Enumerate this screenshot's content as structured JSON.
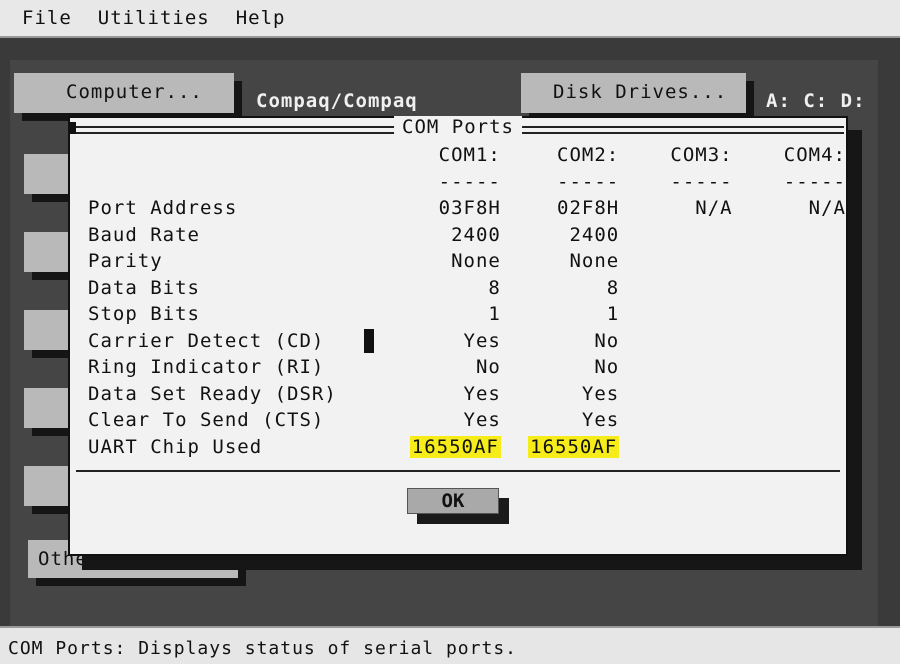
{
  "menu": {
    "file": "File",
    "utilities": "Utilities",
    "help": "Help"
  },
  "background": {
    "computer_button": "Computer...",
    "computer_value": "Compaq/Compaq",
    "disk_button": "Disk Drives...",
    "disk_value": "A: C: D:",
    "other_label": "Other"
  },
  "dialog": {
    "title": "COM Ports",
    "columns": [
      "COM1:",
      "COM2:",
      "COM3:",
      "COM4:"
    ],
    "dashes": "-----",
    "rows": [
      {
        "label": "Port Address",
        "values": [
          "03F8H",
          "02F8H",
          "N/A",
          "N/A"
        ]
      },
      {
        "label": "Baud Rate",
        "values": [
          "2400",
          "2400",
          "",
          ""
        ]
      },
      {
        "label": "Parity",
        "values": [
          "None",
          "None",
          "",
          ""
        ]
      },
      {
        "label": "Data Bits",
        "values": [
          "8",
          "8",
          "",
          ""
        ]
      },
      {
        "label": "Stop Bits",
        "values": [
          "1",
          "1",
          "",
          ""
        ]
      },
      {
        "label": "Carrier Detect (CD)",
        "values": [
          "Yes",
          "No",
          "",
          ""
        ]
      },
      {
        "label": "Ring Indicator (RI)",
        "values": [
          "No",
          "No",
          "",
          ""
        ]
      },
      {
        "label": "Data Set Ready (DSR)",
        "values": [
          "Yes",
          "Yes",
          "",
          ""
        ]
      },
      {
        "label": "Clear To Send (CTS)",
        "values": [
          "Yes",
          "Yes",
          "",
          ""
        ]
      },
      {
        "label": "UART Chip Used",
        "values": [
          "16550AF",
          "16550AF",
          "",
          ""
        ]
      }
    ],
    "ok_label": "OK"
  },
  "status": {
    "text": "COM Ports: Displays status of serial ports."
  },
  "colors": {
    "highlight": "#f5ec1a",
    "dialog_bg": "#f2f2f2",
    "menu_bg": "#e8e8e8"
  }
}
